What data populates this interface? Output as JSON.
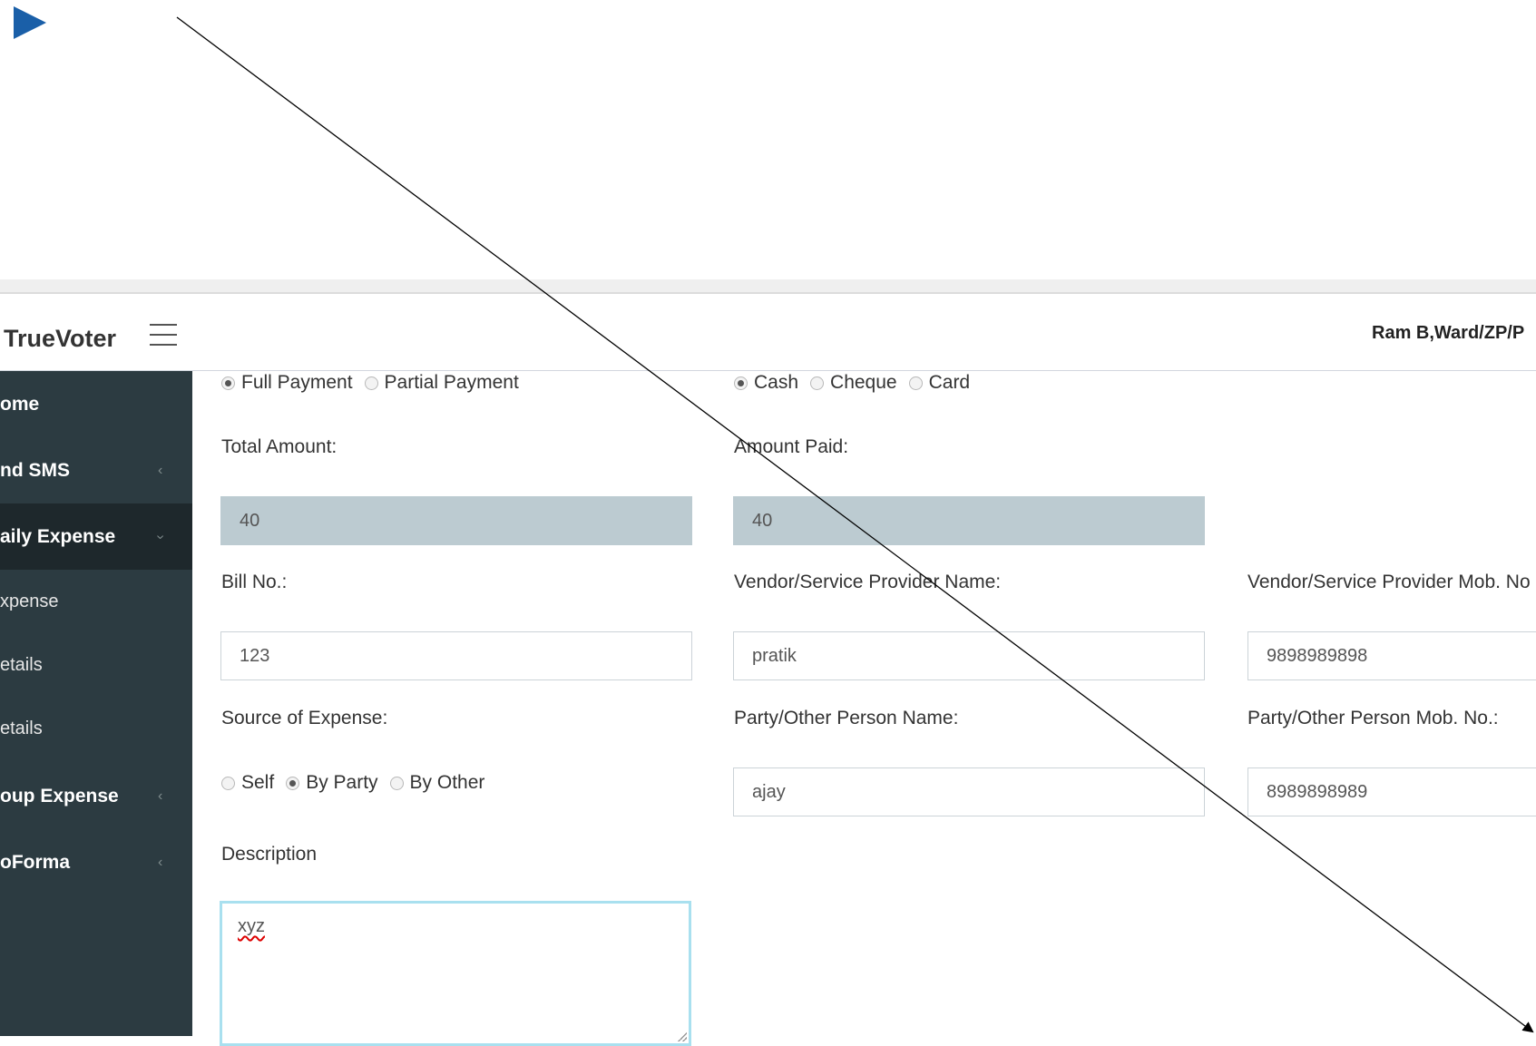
{
  "app": {
    "brand": "TrueVoter",
    "user": "Ram B,Ward/ZP/P"
  },
  "sidebar": {
    "items": [
      {
        "label": "ome"
      },
      {
        "label": "nd SMS",
        "chevron": "‹"
      },
      {
        "label": "aily Expense",
        "chevron": "›"
      },
      {
        "label": "oup Expense",
        "chevron": "‹"
      },
      {
        "label": "oForma",
        "chevron": "‹"
      }
    ],
    "sub_items": [
      {
        "label": "xpense"
      },
      {
        "label": "etails"
      },
      {
        "label": "etails"
      }
    ]
  },
  "form": {
    "payment_type": {
      "options": [
        "Full Payment",
        "Partial Payment"
      ],
      "selected": "Full Payment"
    },
    "payment_mode": {
      "options": [
        "Cash",
        "Cheque",
        "Card"
      ],
      "selected": "Cash"
    },
    "total_amount": {
      "label": "Total Amount:",
      "value": "40"
    },
    "amount_paid": {
      "label": "Amount Paid:",
      "value": "40"
    },
    "bill_no": {
      "label": "Bill No.:",
      "value": "123"
    },
    "vendor_name": {
      "label": "Vendor/Service Provider Name:",
      "value": "pratik"
    },
    "vendor_mob": {
      "label": "Vendor/Service Provider Mob. No",
      "value": "9898989898"
    },
    "source": {
      "label": "Source of Expense:",
      "options": [
        "Self",
        "By Party",
        "By Other"
      ],
      "selected": "By Party"
    },
    "party_name": {
      "label": "Party/Other Person Name:",
      "value": "ajay"
    },
    "party_mob": {
      "label": "Party/Other Person Mob. No.:",
      "value": "8989898989"
    },
    "description": {
      "label": "Description",
      "value": "xyz"
    }
  },
  "colors": {
    "sidebar": "#2c3b41",
    "sidebar_active": "#1e282c",
    "readonly_input": "#bccbd1",
    "play_icon": "#1a5fa8"
  }
}
